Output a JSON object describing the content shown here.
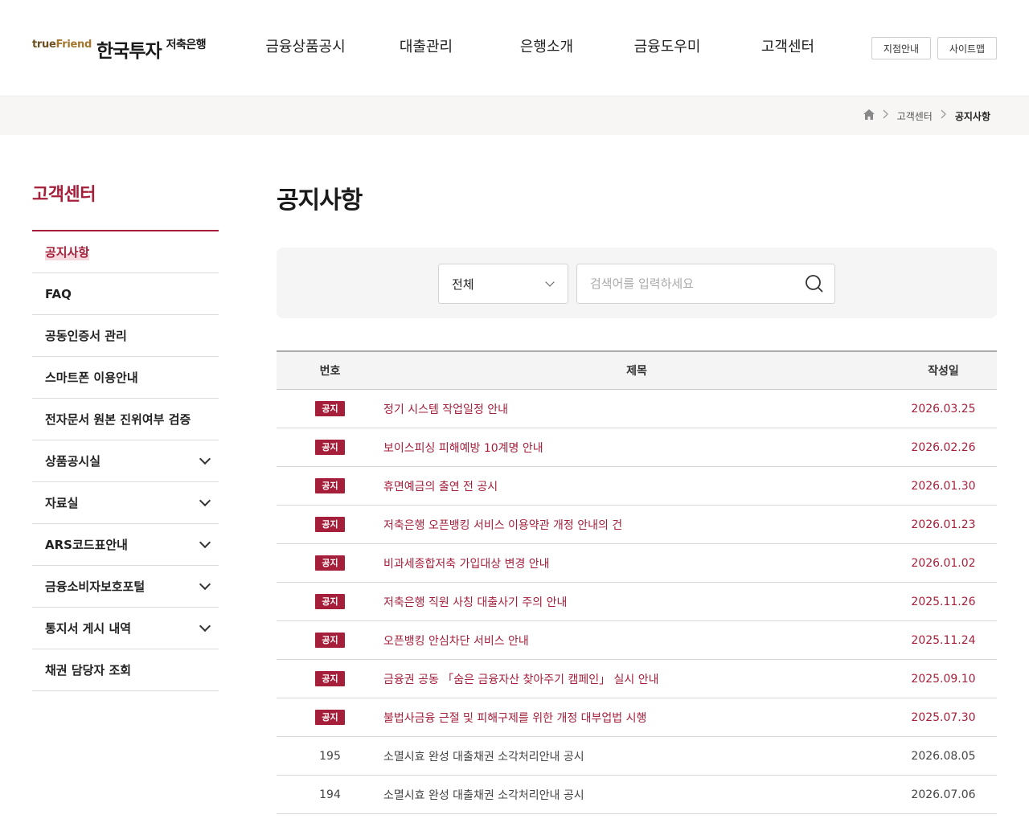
{
  "header": {
    "logo_prefix": "true",
    "logo_brand": "Friend",
    "logo_name": "한국투자",
    "logo_sub": "저축은행",
    "nav": [
      "금융상품공시",
      "대출관리",
      "은행소개",
      "금융도우미",
      "고객센터"
    ],
    "branch_button": "지점안내",
    "sitemap_button": "사이트맵"
  },
  "breadcrumb": {
    "home_icon": "home-icon",
    "level1": "고객센터",
    "current": "공지사항"
  },
  "sidebar": {
    "title": "고객센터",
    "items": [
      {
        "label": "공지사항",
        "active": true,
        "expandable": false
      },
      {
        "label": "FAQ",
        "expandable": false
      },
      {
        "label": "공동인증서 관리",
        "expandable": false
      },
      {
        "label": "스마트폰 이용안내",
        "expandable": false
      },
      {
        "label": "전자문서 원본 진위여부 검증",
        "expandable": false
      },
      {
        "label": "상품공시실",
        "expandable": true
      },
      {
        "label": "자료실",
        "expandable": true
      },
      {
        "label": "ARS코드표안내",
        "expandable": true
      },
      {
        "label": "금융소비자보호포털",
        "expandable": true
      },
      {
        "label": "통지서 게시 내역",
        "expandable": true
      },
      {
        "label": "채권 담당자 조회",
        "expandable": false
      }
    ]
  },
  "main": {
    "title": "공지사항",
    "search": {
      "select_value": "전체",
      "placeholder": "검색어를 입력하세요",
      "value": ""
    },
    "table": {
      "headers": {
        "num": "번호",
        "title": "제목",
        "date": "작성일"
      },
      "notice_badge": "공지",
      "rows": [
        {
          "notice": true,
          "num": "",
          "title": "정기 시스템 작업일정 안내",
          "date": "2026.03.25"
        },
        {
          "notice": true,
          "num": "",
          "title": "보이스피싱 피해예방 10계명 안내",
          "date": "2026.02.26"
        },
        {
          "notice": true,
          "num": "",
          "title": "휴면예금의 출연 전 공시",
          "date": "2026.01.30"
        },
        {
          "notice": true,
          "num": "",
          "title": "저축은행 오픈뱅킹 서비스 이용약관 개정 안내의 건",
          "date": "2026.01.23"
        },
        {
          "notice": true,
          "num": "",
          "title": "비과세종합저축 가입대상 변경 안내",
          "date": "2026.01.02"
        },
        {
          "notice": true,
          "num": "",
          "title": "저축은행 직원 사칭 대출사기 주의 안내",
          "date": "2025.11.26"
        },
        {
          "notice": true,
          "num": "",
          "title": "오픈뱅킹 안심차단 서비스 안내",
          "date": "2025.11.24"
        },
        {
          "notice": true,
          "num": "",
          "title": "금융권 공동 「숨은 금융자산 찾아주기 캠페인」 실시 안내",
          "date": "2025.09.10"
        },
        {
          "notice": true,
          "num": "",
          "title": "불법사금융 근절 및 피해구제를 위한 개정 대부업법 시행",
          "date": "2025.07.30"
        },
        {
          "notice": false,
          "num": "195",
          "title": "소멸시효 완성 대출채권 소각처리안내 공시",
          "date": "2026.08.05"
        },
        {
          "notice": false,
          "num": "194",
          "title": "소멸시효 완성 대출채권 소각처리안내 공시",
          "date": "2026.07.06"
        }
      ]
    }
  },
  "colors": {
    "accent": "#a51e3a",
    "brand_gold": "#a5762e"
  }
}
